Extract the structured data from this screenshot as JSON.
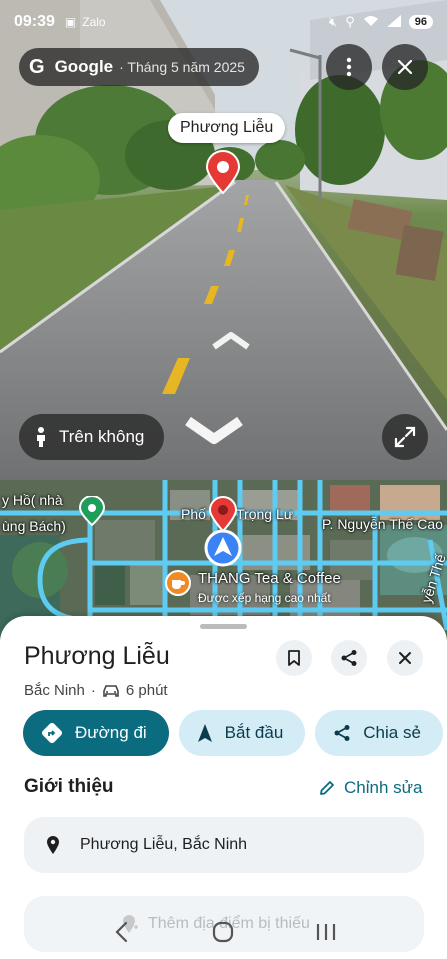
{
  "status_bar": {
    "time": "09:39",
    "notification_icons": [
      "screenshot-icon",
      "zalo-icon"
    ],
    "zalo_label": "Zalo",
    "battery": "96"
  },
  "street_view": {
    "brand": "Google",
    "capture_date": "· Tháng 5 năm 2025",
    "place_bubble": "Phương Liễu",
    "aerial_button_label": "Trên không"
  },
  "map": {
    "labels": {
      "left_place_1": "y Hồ( nhà",
      "left_place_2": "ùng Bách)",
      "street_pho": "Phố",
      "street_trong_lu": "Trọng Lư",
      "street_nguyen_the_cao": "P. Nguyễn Thế Cao",
      "street_right_vertical": "yễn Thế",
      "poi_name": "THANG Tea & Coffee",
      "poi_sub": "Được xếp hạng cao nhất"
    }
  },
  "sheet": {
    "title": "Phương Liễu",
    "region": "Bắc Ninh",
    "separator": "·",
    "drive_time": "6 phút",
    "chips": {
      "directions": "Đường đi",
      "start": "Bắt đầu",
      "share": "Chia sẻ"
    },
    "intro_heading": "Giới thiệu",
    "edit_label": "Chỉnh sửa",
    "address": "Phương Liễu, Bắc Ninh",
    "add_missing_place": "Thêm địa điểm bị thiếu"
  },
  "colors": {
    "primary": "#0b6b7f",
    "chip_light": "#d4ecf6",
    "pin_red": "#e53935",
    "map_road": "#5ecbf2"
  }
}
